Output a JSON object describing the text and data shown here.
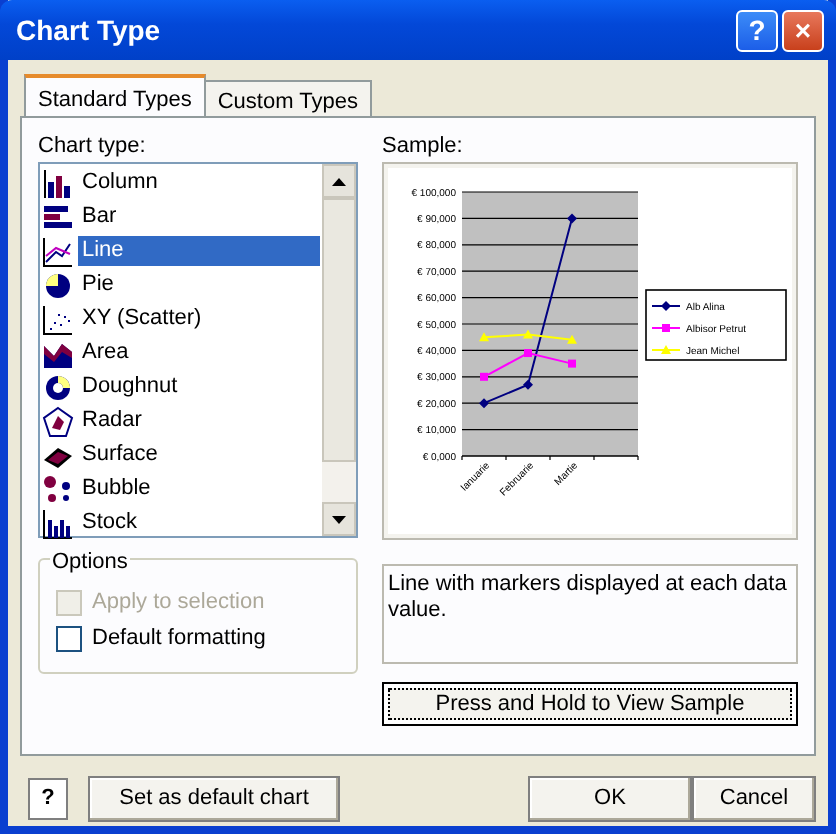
{
  "window": {
    "title": "Chart Type",
    "buttons": [
      "?",
      "×"
    ]
  },
  "tabs": [
    {
      "label": "Standard Types",
      "selected": true
    },
    {
      "label": "Custom Types",
      "selected": false
    }
  ],
  "chart_type_label": "Chart type:",
  "chart_types": [
    {
      "label": "Column",
      "selected": false
    },
    {
      "label": "Bar",
      "selected": false
    },
    {
      "label": "Line",
      "selected": true
    },
    {
      "label": "Pie",
      "selected": false
    },
    {
      "label": "XY (Scatter)",
      "selected": false
    },
    {
      "label": "Area",
      "selected": false
    },
    {
      "label": "Doughnut",
      "selected": false
    },
    {
      "label": "Radar",
      "selected": false
    },
    {
      "label": "Surface",
      "selected": false
    },
    {
      "label": "Bubble",
      "selected": false
    },
    {
      "label": "Stock",
      "selected": false
    }
  ],
  "sample_label": "Sample:",
  "sample": {
    "chart_data": {
      "type": "line",
      "categories": [
        "Ianuarie",
        "Februarie",
        "Martie"
      ],
      "series": [
        {
          "name": "Alb Alina",
          "color": "#000080",
          "marker": "diamond",
          "values": [
            20000,
            27000,
            90000
          ]
        },
        {
          "name": "Albisor Petrut",
          "color": "#ff00ff",
          "marker": "square",
          "values": [
            30000,
            39000,
            35000
          ]
        },
        {
          "name": "Jean Michel",
          "color": "#ffff00",
          "marker": "triangle",
          "values": [
            45000,
            46000,
            44000
          ]
        }
      ],
      "grid": true,
      "legend": true,
      "ylim": [
        0,
        100000
      ],
      "yticks": [
        {
          "value": 0,
          "label": "€ 0,000"
        },
        {
          "value": 10000,
          "label": "€ 10,000"
        },
        {
          "value": 20000,
          "label": "€ 20,000"
        },
        {
          "value": 30000,
          "label": "€ 30,000"
        },
        {
          "value": 40000,
          "label": "€ 40,000"
        },
        {
          "value": 50000,
          "label": "€ 50,000"
        },
        {
          "value": 60000,
          "label": "€ 60,000"
        },
        {
          "value": 70000,
          "label": "€ 70,000"
        },
        {
          "value": 80000,
          "label": "€ 80,000"
        },
        {
          "value": 90000,
          "label": "€ 90,000"
        },
        {
          "value": 100000,
          "label": "€ 100,000"
        }
      ]
    }
  },
  "options": {
    "title": "Options",
    "items": [
      {
        "label": "Apply to selection",
        "checked": false,
        "disabled": true
      },
      {
        "label": "Default formatting",
        "checked": false,
        "disabled": false
      }
    ]
  },
  "description": "Line with markers displayed at each data value.",
  "preview_button": "Press and Hold to View Sample",
  "footer": {
    "help": "?",
    "default_button": "Set as default chart",
    "ok": "OK",
    "cancel": "Cancel"
  }
}
